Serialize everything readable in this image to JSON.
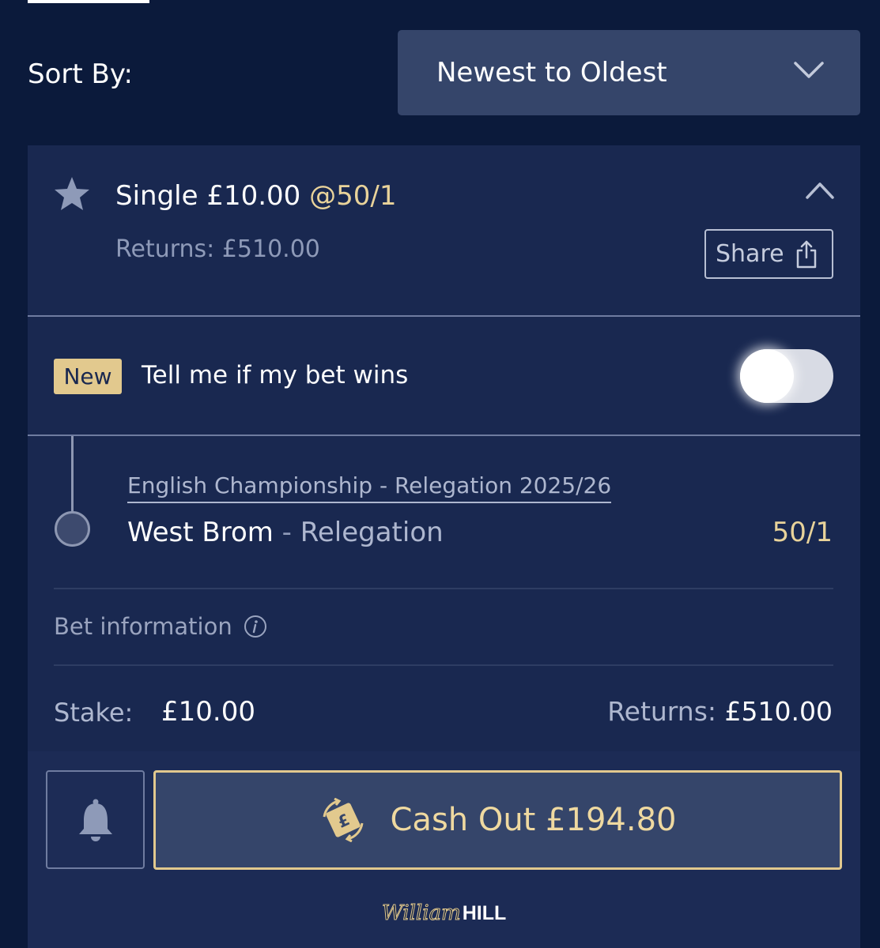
{
  "sort": {
    "label": "Sort By:",
    "selected": "Newest to Oldest"
  },
  "bet": {
    "title": "Single £10.00",
    "title_odds": "@50/1",
    "returns": "Returns: £510.00",
    "share_label": "Share",
    "new_badge": "New",
    "notify_label": "Tell me if my bet wins",
    "notify_enabled": false,
    "market": "English Championship - Relegation 2025/26",
    "selection_team": "West Brom",
    "selection_sep": " - ",
    "selection_market": "Relegation",
    "selection_odds": "50/1",
    "bet_info_label": "Bet information",
    "stake_label": "Stake:",
    "stake_value": "£10.00",
    "returns_label": "Returns:",
    "returns_value": "£510.00",
    "cashout_label": "Cash Out £194.80"
  },
  "logo": {
    "script": "William",
    "bold": "HILL"
  },
  "colors": {
    "background": "#0b1a3b",
    "card": "#192850",
    "gold": "#e2c98e",
    "select": "#35456a"
  },
  "icons": [
    "star-icon",
    "chevron-down-icon",
    "chevron-up-icon",
    "share-icon",
    "info-icon",
    "bell-icon",
    "cashout-icon"
  ]
}
